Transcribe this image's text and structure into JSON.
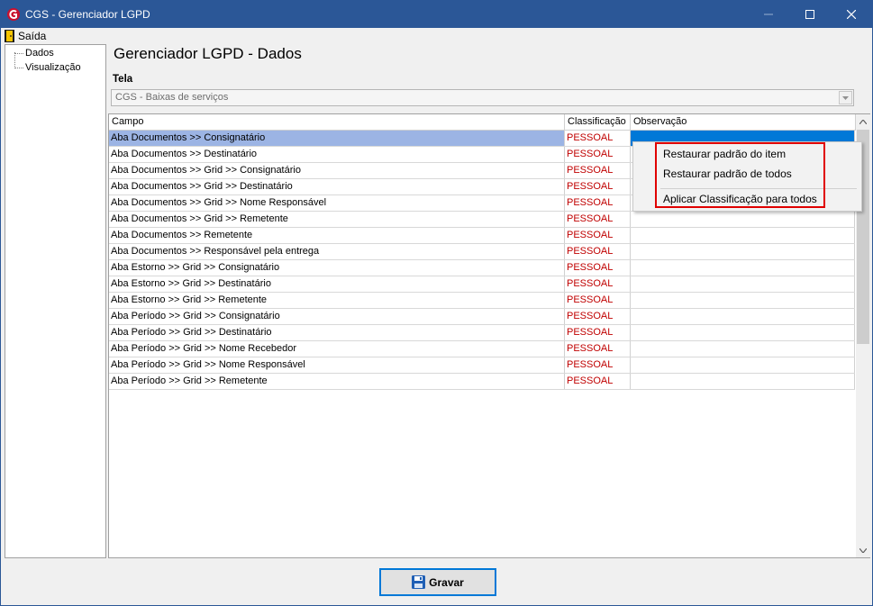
{
  "window": {
    "title": "CGS - Gerenciador LGPD"
  },
  "menu": {
    "saida": "Saída"
  },
  "tree": {
    "items": [
      "Dados",
      "Visualização"
    ]
  },
  "page": {
    "title": "Gerenciador LGPD - Dados"
  },
  "tela": {
    "label": "Tela",
    "value": "CGS - Baixas de serviços"
  },
  "grid": {
    "columns": [
      "Campo",
      "Classificação",
      "Observação"
    ],
    "rows": [
      {
        "campo": "Aba Documentos >> Consignatário",
        "classificacao": "PESSOAL",
        "observacao": ""
      },
      {
        "campo": "Aba Documentos >> Destinatário",
        "classificacao": "PESSOAL",
        "observacao": ""
      },
      {
        "campo": "Aba Documentos >> Grid >> Consignatário",
        "classificacao": "PESSOAL",
        "observacao": ""
      },
      {
        "campo": "Aba Documentos >> Grid >> Destinatário",
        "classificacao": "PESSOAL",
        "observacao": ""
      },
      {
        "campo": "Aba Documentos >> Grid >> Nome Responsável",
        "classificacao": "PESSOAL",
        "observacao": ""
      },
      {
        "campo": "Aba Documentos >> Grid >> Remetente",
        "classificacao": "PESSOAL",
        "observacao": ""
      },
      {
        "campo": "Aba Documentos >> Remetente",
        "classificacao": "PESSOAL",
        "observacao": ""
      },
      {
        "campo": "Aba Documentos >> Responsável pela entrega",
        "classificacao": "PESSOAL",
        "observacao": ""
      },
      {
        "campo": "Aba Estorno >> Grid >> Consignatário",
        "classificacao": "PESSOAL",
        "observacao": ""
      },
      {
        "campo": "Aba Estorno >> Grid >> Destinatário",
        "classificacao": "PESSOAL",
        "observacao": ""
      },
      {
        "campo": "Aba Estorno >> Grid >> Remetente",
        "classificacao": "PESSOAL",
        "observacao": ""
      },
      {
        "campo": "Aba Período >> Grid >> Consignatário",
        "classificacao": "PESSOAL",
        "observacao": ""
      },
      {
        "campo": "Aba Período >> Grid >> Destinatário",
        "classificacao": "PESSOAL",
        "observacao": ""
      },
      {
        "campo": "Aba Período >> Grid >> Nome Recebedor",
        "classificacao": "PESSOAL",
        "observacao": ""
      },
      {
        "campo": "Aba Período >> Grid >> Nome Responsável",
        "classificacao": "PESSOAL",
        "observacao": ""
      },
      {
        "campo": "Aba Período >> Grid >> Remetente",
        "classificacao": "PESSOAL",
        "observacao": ""
      }
    ]
  },
  "context_menu": {
    "items": [
      "Restaurar padrão do item",
      "Restaurar padrão de todos",
      "Aplicar Classificação para todos"
    ]
  },
  "footer": {
    "save_label": "Gravar"
  },
  "colors": {
    "titlebar": "#2b5797",
    "selection": "#9cb4e4",
    "classification_text": "#c00000",
    "highlight": "#e00000"
  }
}
